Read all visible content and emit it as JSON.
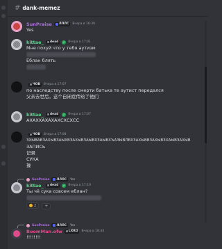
{
  "channel": {
    "name": "dank-memez"
  },
  "messages": [
    {
      "id": "m1",
      "username": "SunPraise",
      "tag": "ЛЛЛС",
      "time": "Вчера в 16:30",
      "lines": [
        "Yes"
      ]
    },
    {
      "id": "m2",
      "username": "kittae_",
      "tag": "dead",
      "time": "Вчера в 17:01",
      "lines": [
        "Мне похуй что у тебя аутизм",
        "Еблан блять"
      ]
    },
    {
      "id": "m3",
      "username": "",
      "tag": "ЧОВ",
      "time": "Вчера в 17:07",
      "lines": [
        "по наследству после смерти батька те аутист передался",
        "父亲去世后，这个自闭症传给了他们"
      ]
    },
    {
      "id": "m4",
      "username": "kittae_",
      "tag": "dead",
      "time": "Вчера в 17:07",
      "lines": [
        "АХАХХАХАХАХСХСХСС"
      ]
    },
    {
      "id": "m5",
      "username": "",
      "tag": "ЧОВ",
      "time": "Вчера в 17:08",
      "lines": [
        "ЗХЫВАВЗАХЫВЗАЫХВЗАХЫВЗАЫВХЗАЫВХЪАЗЫВЛВХЗАХЫВВЗАХЫВЗХАЫВЗАХЫВ",
        "ЗАПИСЬ",
        "记录",
        "СУКА",
        "操"
      ]
    },
    {
      "id": "m6",
      "reply_to": {
        "username": "SunPraise",
        "tag": "ЛЛЛС",
        "text": "Yes"
      },
      "username": "kittae_",
      "tag": "dead",
      "time": "Вчера в 17:10",
      "lines": [
        "Ты чё сука совсем еблан?"
      ],
      "reactions": [
        {
          "emoji": "laugh",
          "count": "2"
        }
      ]
    },
    {
      "id": "m7",
      "reply_to": {
        "username": "SunPraise",
        "tag": "ЛЛЛС",
        "text": "Yes"
      },
      "username": "BoomMan.ofw",
      "tag": "LXRD",
      "time": "Вчера в 18:44",
      "lines": [
        "!!!!!!!!"
      ]
    }
  ],
  "icons": {
    "hash": "#",
    "verified": "✓",
    "add_reaction": "+"
  }
}
